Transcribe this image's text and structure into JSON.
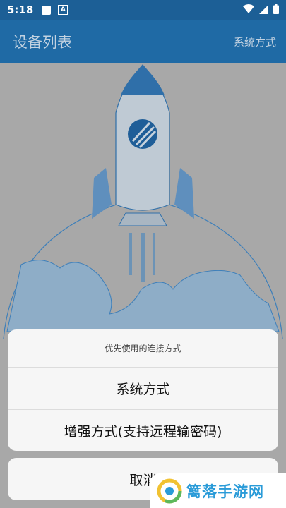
{
  "status_bar": {
    "time": "5:18",
    "a_glyph": "A"
  },
  "app_bar": {
    "title": "设备列表",
    "action": "系统方式"
  },
  "dialog": {
    "title": "优先使用的连接方式",
    "options": [
      "系统方式",
      "增强方式(支持远程输密码)"
    ],
    "cancel": "取消"
  },
  "watermark": {
    "text": "篱落手游网"
  },
  "colors": {
    "status_bar": "#1c5f96",
    "app_bar": "#1f6aa5",
    "scrim": "#a8a8a8",
    "sheet": "#f6f6f6",
    "rocket_blue": "#2f6fa9"
  },
  "icons": [
    "picture-icon",
    "a-icon",
    "wifi-icon",
    "signal-icon",
    "battery-icon",
    "rocket-illustration",
    "watermark-logo-icon"
  ]
}
